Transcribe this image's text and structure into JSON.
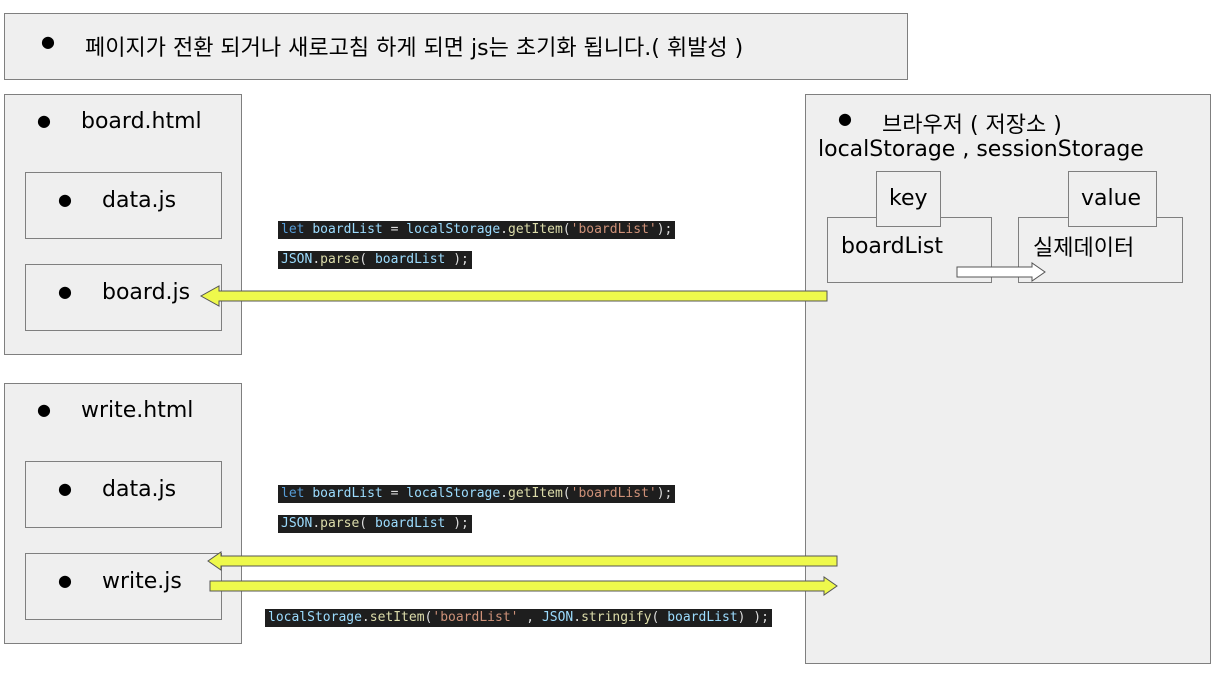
{
  "header": {
    "text": "페이지가 전환 되거나 새로고침 하게 되면 js는 초기화 됩니다.( 휘발성 )"
  },
  "board_page": {
    "title": "board.html",
    "data_js": "data.js",
    "board_js": "board.js"
  },
  "write_page": {
    "title": "write.html",
    "data_js": "data.js",
    "write_js": "write.js"
  },
  "browser": {
    "title": "브라우저 ( 저장소 )",
    "storages": "localStorage , sessionStorage",
    "key_label": "key",
    "value_label": "value",
    "key_value": "boardList",
    "value_value": "실제데이터"
  },
  "code": {
    "get_item": {
      "keyword": "let",
      "var": "boardList",
      "eq": " = ",
      "obj": "localStorage",
      "dot": ".",
      "method": "getItem",
      "open": "(",
      "arg": "'boardList'",
      "close": ");"
    },
    "parse": {
      "obj": "JSON",
      "dot": ".",
      "method": "parse",
      "open": "( ",
      "arg": "boardList",
      "close": " );"
    },
    "set_item": {
      "obj": "localStorage",
      "dot": ".",
      "method": "setItem",
      "open": "(",
      "arg1": "'boardList'",
      "sep": " , ",
      "obj2": "JSON",
      "dot2": ".",
      "method2": "stringify",
      "open2": "( ",
      "arg2": "boardList",
      "close": ") );"
    }
  },
  "colors": {
    "arrow_fill": "#eef94c",
    "arrow_stroke": "#555555",
    "box_fill": "#efefef",
    "code_bg": "#1e1e1e"
  }
}
